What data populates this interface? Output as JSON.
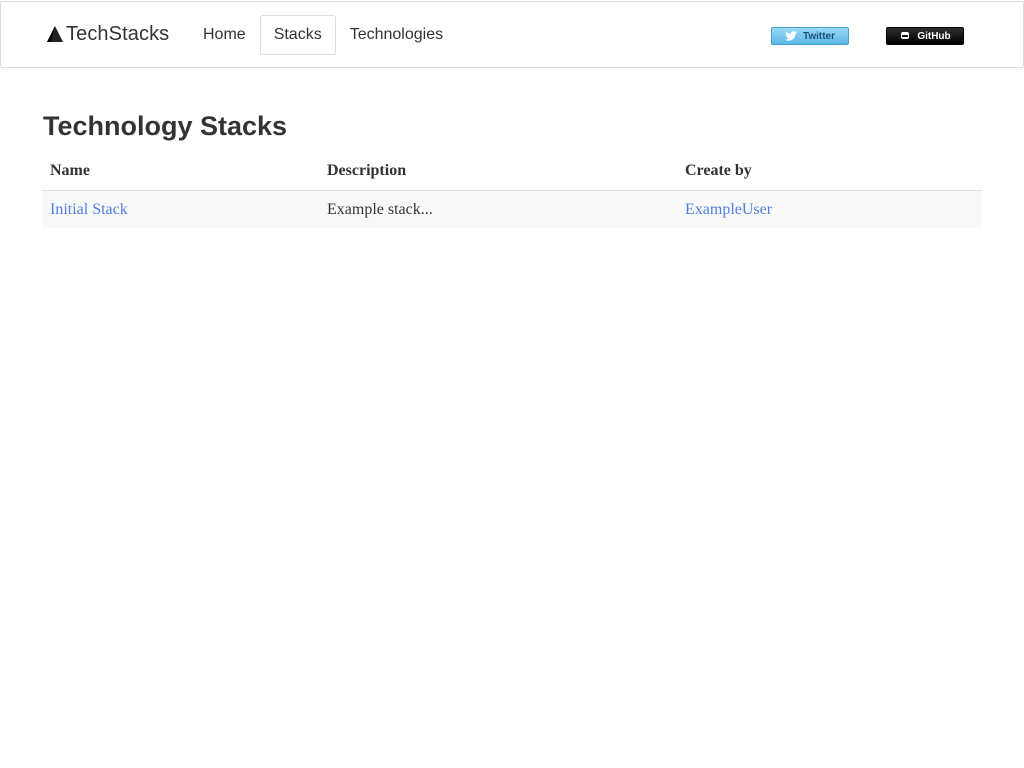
{
  "navbar": {
    "brand": "TechStacks",
    "links": [
      {
        "label": "Home",
        "active": false
      },
      {
        "label": "Stacks",
        "active": true
      },
      {
        "label": "Technologies",
        "active": false
      }
    ],
    "twitter_label": "Twitter",
    "github_label": "GitHub"
  },
  "main": {
    "title": "Technology Stacks",
    "table": {
      "headers": [
        "Name",
        "Description",
        "Create by"
      ],
      "rows": [
        {
          "name": "Initial Stack",
          "description": "Example stack...",
          "created_by": "ExampleUser"
        }
      ]
    }
  },
  "colors": {
    "link": "#4f7fe0",
    "text": "#333333",
    "row_stripe": "#f9f9f9",
    "twitter": "#5cb6e8",
    "github": "#000000"
  },
  "icons": {
    "brand": "sail-logo-icon",
    "twitter": "twitter-bird-icon",
    "github": "github-octocat-icon"
  }
}
